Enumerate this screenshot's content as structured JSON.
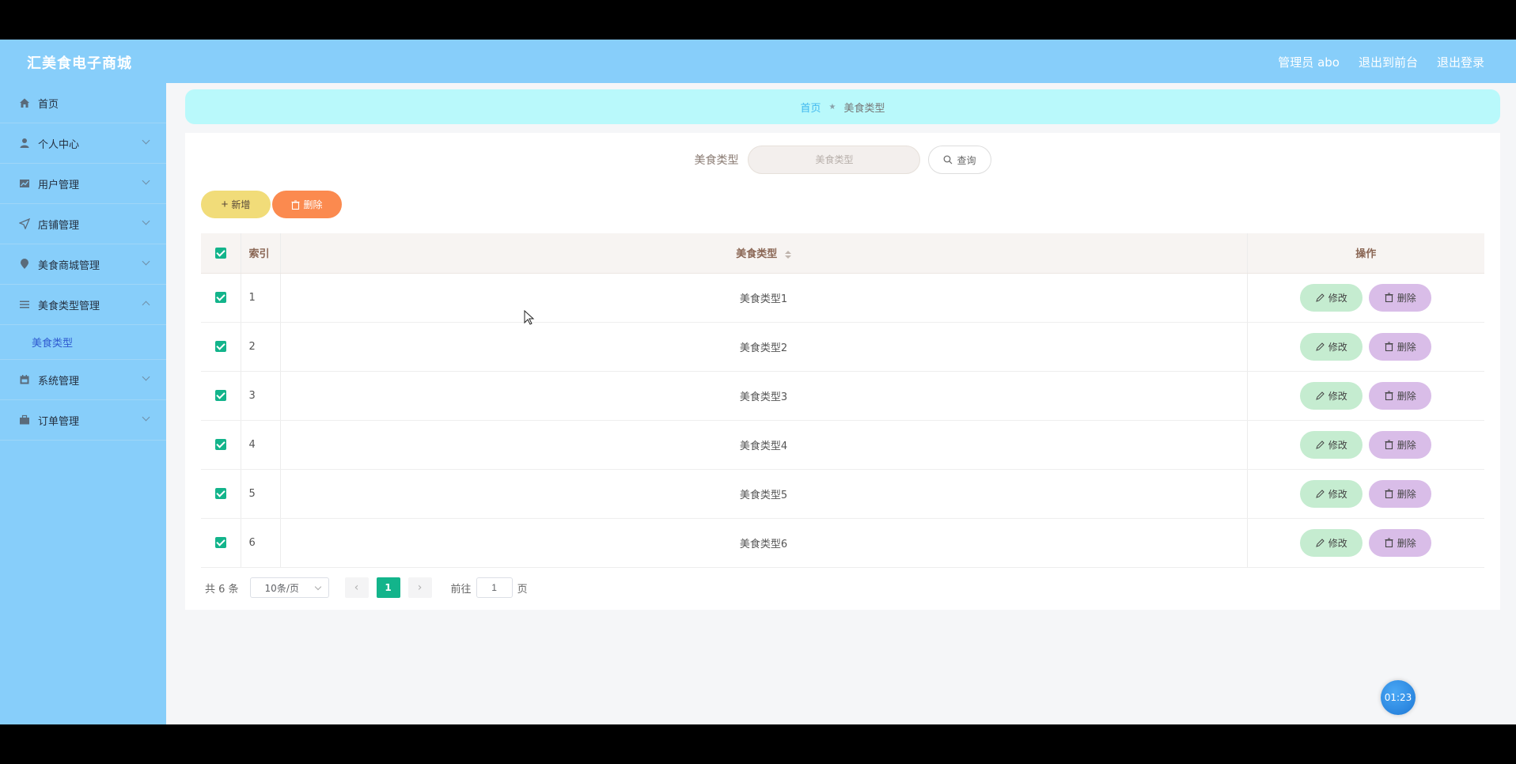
{
  "header": {
    "brand": "汇美食电子商城",
    "admin": "管理员 abo",
    "to_front": "退出到前台",
    "logout": "退出登录"
  },
  "sidebar": {
    "items": [
      {
        "label": "首页",
        "icon": "home-icon"
      },
      {
        "label": "个人中心",
        "icon": "user-icon"
      },
      {
        "label": "用户管理",
        "icon": "chart-icon"
      },
      {
        "label": "店铺管理",
        "icon": "send-icon"
      },
      {
        "label": "美食商城管理",
        "icon": "location-icon"
      },
      {
        "label": "美食类型管理",
        "icon": "menu-icon"
      },
      {
        "label": "系统管理",
        "icon": "calendar-icon"
      },
      {
        "label": "订单管理",
        "icon": "briefcase-icon"
      }
    ],
    "sub_active": "美食类型"
  },
  "breadcrumb": {
    "home": "首页",
    "current": "美食类型"
  },
  "search": {
    "label": "美食类型",
    "placeholder": "美食类型",
    "query_label": "查询"
  },
  "actions": {
    "add_label": "新增",
    "delete_label": "删除"
  },
  "table": {
    "headers": {
      "index": "索引",
      "type": "美食类型",
      "op": "操作"
    },
    "edit_label": "修改",
    "delete_label": "删除",
    "rows": [
      {
        "index": "1",
        "type": "美食类型1"
      },
      {
        "index": "2",
        "type": "美食类型2"
      },
      {
        "index": "3",
        "type": "美食类型3"
      },
      {
        "index": "4",
        "type": "美食类型4"
      },
      {
        "index": "5",
        "type": "美食类型5"
      },
      {
        "index": "6",
        "type": "美食类型6"
      }
    ]
  },
  "pagination": {
    "total": "共 6 条",
    "page_size": "10条/页",
    "current_page": "1",
    "goto_prefix": "前往",
    "goto_value": "1",
    "goto_suffix": "页"
  },
  "timer": "01:23",
  "colors": {
    "header_bg": "#87cefa",
    "sidebar_bg": "#87cefa",
    "breadcrumb_bg": "#b9f9fb",
    "accent_green": "#13b48b",
    "add_btn": "#f1dc79",
    "delete_btn": "#fb8a4f",
    "edit_btn": "#c5ecd0",
    "row_delete_btn": "#d9bde8"
  }
}
